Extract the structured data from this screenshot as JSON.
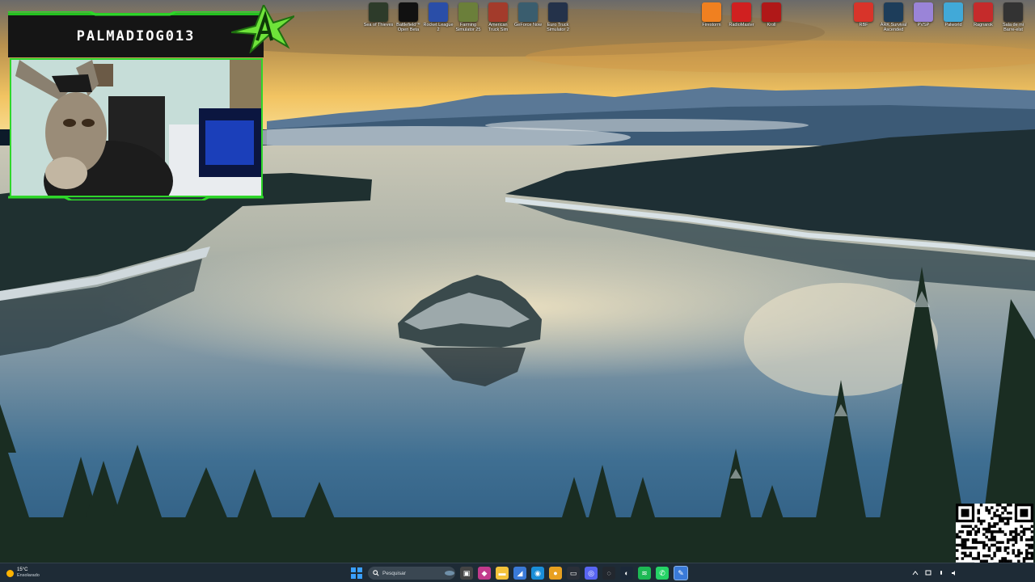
{
  "overlay": {
    "streamer_name": "PALMADIOG013"
  },
  "desktop_icons_left": [
    {
      "label": "Sea of Thieves",
      "icon": "skull-ship-icon",
      "color": "#2d3b2a"
    },
    {
      "label": "Battlefield™ Open Beta",
      "icon": "bf-logo-icon",
      "color": "#111111"
    },
    {
      "label": "Rocket League 2",
      "icon": "rocket-league-icon",
      "color": "#2a4ea8"
    },
    {
      "label": "Farming Simulator 25",
      "icon": "tractor-icon",
      "color": "#6b7f3a"
    },
    {
      "label": "American Truck Sim",
      "icon": "truck-icon",
      "color": "#a33b2b"
    },
    {
      "label": "GeForce Now",
      "icon": "car-icon",
      "color": "#3a5d6e"
    },
    {
      "label": "Euro Truck Simulator 2",
      "icon": "euro-truck-icon",
      "color": "#24324a"
    }
  ],
  "desktop_icons_mid": [
    {
      "label": "Firestorm",
      "icon": "firestorm-icon",
      "color": "#f08020"
    },
    {
      "label": "RadioMaster",
      "icon": "radio-icon",
      "color": "#d02020"
    },
    {
      "label": "Kroll",
      "icon": "kroll-icon",
      "color": "#b01818"
    }
  ],
  "desktop_icons_right": [
    {
      "label": "RBF",
      "icon": "mascot-icon",
      "color": "#d8342a"
    },
    {
      "label": "ARK Survival Ascended",
      "icon": "ark-icon",
      "color": "#1d3d5a"
    },
    {
      "label": "PVSP",
      "icon": "pvsp-icon",
      "color": "#9a84d8"
    },
    {
      "label": "Palworld",
      "icon": "palworld-icon",
      "color": "#41a9d8"
    },
    {
      "label": "Ragnarok",
      "icon": "ragnarok-icon",
      "color": "#c52b2b"
    },
    {
      "label": "Sala de mi Barre-elst",
      "icon": "openai-icon",
      "color": "#333333"
    }
  ],
  "taskbar": {
    "weather_temp": "15°C",
    "weather_desc": "Ensolarado",
    "search_placeholder": "Pesquisar"
  },
  "colors": {
    "overlay_green": "#2fd62a",
    "taskbar_bg": "#1e2b36"
  }
}
